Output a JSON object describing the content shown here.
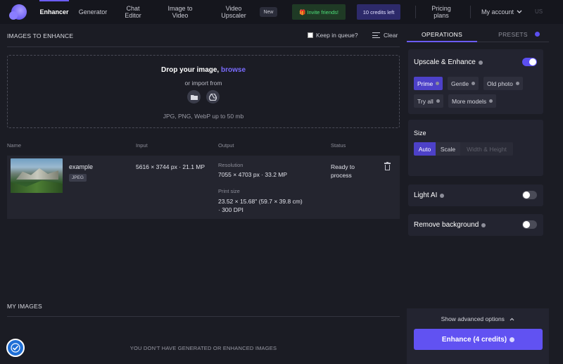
{
  "nav": {
    "items": [
      {
        "label": "Enhancer",
        "active": true
      },
      {
        "label": "Generator"
      },
      {
        "label": "Chat Editor"
      },
      {
        "label": "Image to Video"
      },
      {
        "label": "Video Upscaler"
      }
    ],
    "new_badge": "New",
    "invite_label": "🎁 Invite friends!",
    "credits_label": "10 credits left",
    "pricing_label": "Pricing plans",
    "account_label": "My account",
    "lang_label": "US"
  },
  "images_section": {
    "title": "IMAGES TO ENHANCE",
    "keep_in_queue": "Keep in queue?",
    "clear": "Clear"
  },
  "dropzone": {
    "title": "Drop your image,",
    "browse": "browse",
    "import_from": "or import from",
    "import_icons": [
      "folder-icon",
      "google-drive-icon"
    ],
    "formats": "JPG, PNG, WebP up to 50 mb"
  },
  "table": {
    "headers": [
      "Name",
      "Input",
      "Output",
      "Status"
    ],
    "row": {
      "name": "example",
      "type": "JPEG",
      "input": "5616 × 3744 px · 21.1 MP",
      "resolution_label": "Resolution",
      "resolution": "7055 × 4703 px · 33.2 MP",
      "print_label": "Print size",
      "print_size_line1": "23.52 × 15.68\" (59.7 × 39.8 cm)",
      "print_size_line2": "· 300 DPI",
      "status_line1": "Ready to",
      "status_line2": "process"
    }
  },
  "my_images": {
    "title": "MY IMAGES",
    "empty": "YOU DON'T HAVE GENERATED OR ENHANCED IMAGES"
  },
  "panel": {
    "tabs": [
      {
        "label": "OPERATIONS",
        "active": true
      },
      {
        "label": "PRESETS"
      }
    ],
    "upscale": {
      "title": "Upscale & Enhance",
      "enabled": true,
      "models": [
        {
          "label": "Prime",
          "selected": true
        },
        {
          "label": "Gentle"
        },
        {
          "label": "Old photo"
        },
        {
          "label": "Try all"
        },
        {
          "label": "More models"
        }
      ]
    },
    "size": {
      "title": "Size",
      "options": [
        {
          "label": "Auto",
          "selected": true
        },
        {
          "label": "Scale"
        },
        {
          "label": "Width & Height",
          "disabled": true
        }
      ]
    },
    "light_ai": {
      "title": "Light AI",
      "enabled": false
    },
    "remove_bg": {
      "title": "Remove background",
      "enabled": false
    },
    "advanced": "Show advanced options",
    "enhance_button": "Enhance (4 credits)"
  },
  "colors": {
    "accent": "#6152f2",
    "background": "#1b1c24",
    "panel": "#232430",
    "invite_green": "#4ee07a"
  }
}
